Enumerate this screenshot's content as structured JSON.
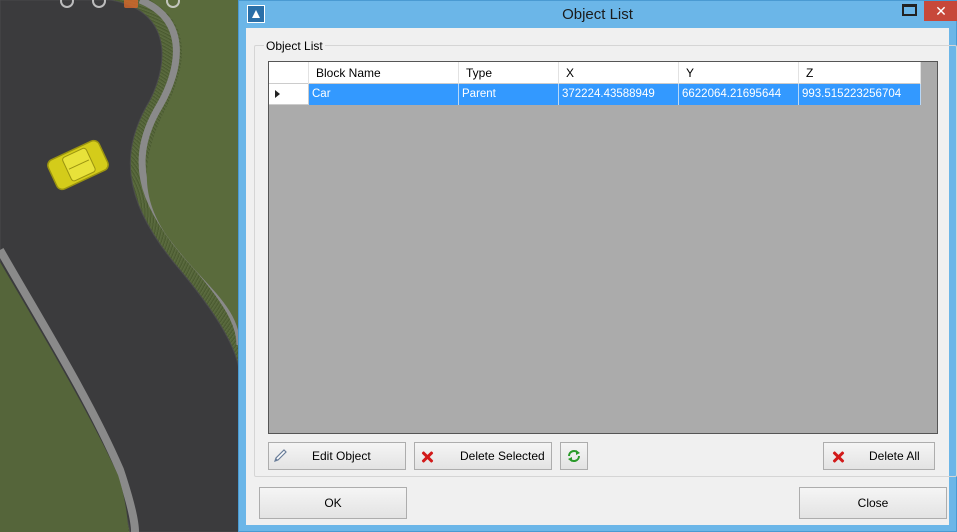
{
  "window": {
    "title": "Object List",
    "close_glyph": "✕"
  },
  "groupbox": {
    "label": "Object List"
  },
  "grid": {
    "columns": [
      "Block Name",
      "Type",
      "X",
      "Y",
      "Z"
    ],
    "rows": [
      {
        "block_name": "Car",
        "type": "Parent",
        "x": "372224.43588949",
        "y": "6622064.21695644",
        "z": "993.515223256704",
        "selected": true
      }
    ]
  },
  "toolbar": {
    "edit_object_label": "Edit Object",
    "delete_selected_label": "Delete Selected",
    "delete_all_label": "Delete All"
  },
  "footer": {
    "ok_label": "OK",
    "close_label": "Close"
  },
  "colors": {
    "title_bar": "#6bb6e8",
    "selection": "#3399ff",
    "close_button": "#c7483a",
    "grid_empty": "#ababab"
  },
  "icons": {
    "app": "app-logo-icon",
    "edit": "pencil-icon",
    "delete": "red-x-icon",
    "refresh": "refresh-icon"
  }
}
